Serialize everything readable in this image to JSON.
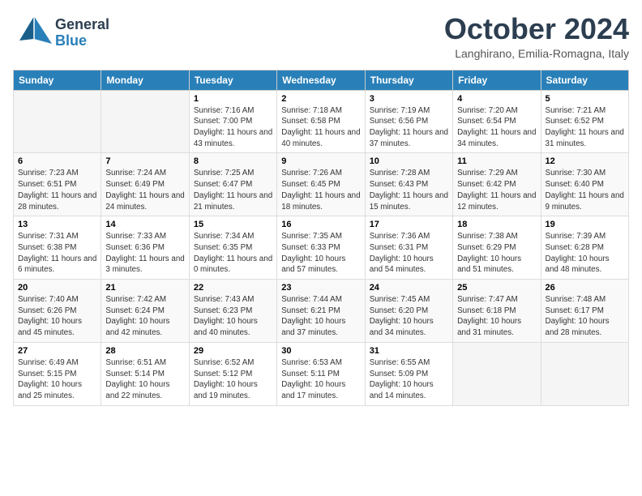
{
  "header": {
    "logo_general": "General",
    "logo_blue": "Blue",
    "month": "October 2024",
    "location": "Langhirano, Emilia-Romagna, Italy"
  },
  "days_of_week": [
    "Sunday",
    "Monday",
    "Tuesday",
    "Wednesday",
    "Thursday",
    "Friday",
    "Saturday"
  ],
  "weeks": [
    [
      {
        "day": "",
        "sunrise": "",
        "sunset": "",
        "daylight": ""
      },
      {
        "day": "",
        "sunrise": "",
        "sunset": "",
        "daylight": ""
      },
      {
        "day": "1",
        "sunrise": "Sunrise: 7:16 AM",
        "sunset": "Sunset: 7:00 PM",
        "daylight": "Daylight: 11 hours and 43 minutes."
      },
      {
        "day": "2",
        "sunrise": "Sunrise: 7:18 AM",
        "sunset": "Sunset: 6:58 PM",
        "daylight": "Daylight: 11 hours and 40 minutes."
      },
      {
        "day": "3",
        "sunrise": "Sunrise: 7:19 AM",
        "sunset": "Sunset: 6:56 PM",
        "daylight": "Daylight: 11 hours and 37 minutes."
      },
      {
        "day": "4",
        "sunrise": "Sunrise: 7:20 AM",
        "sunset": "Sunset: 6:54 PM",
        "daylight": "Daylight: 11 hours and 34 minutes."
      },
      {
        "day": "5",
        "sunrise": "Sunrise: 7:21 AM",
        "sunset": "Sunset: 6:52 PM",
        "daylight": "Daylight: 11 hours and 31 minutes."
      }
    ],
    [
      {
        "day": "6",
        "sunrise": "Sunrise: 7:23 AM",
        "sunset": "Sunset: 6:51 PM",
        "daylight": "Daylight: 11 hours and 28 minutes."
      },
      {
        "day": "7",
        "sunrise": "Sunrise: 7:24 AM",
        "sunset": "Sunset: 6:49 PM",
        "daylight": "Daylight: 11 hours and 24 minutes."
      },
      {
        "day": "8",
        "sunrise": "Sunrise: 7:25 AM",
        "sunset": "Sunset: 6:47 PM",
        "daylight": "Daylight: 11 hours and 21 minutes."
      },
      {
        "day": "9",
        "sunrise": "Sunrise: 7:26 AM",
        "sunset": "Sunset: 6:45 PM",
        "daylight": "Daylight: 11 hours and 18 minutes."
      },
      {
        "day": "10",
        "sunrise": "Sunrise: 7:28 AM",
        "sunset": "Sunset: 6:43 PM",
        "daylight": "Daylight: 11 hours and 15 minutes."
      },
      {
        "day": "11",
        "sunrise": "Sunrise: 7:29 AM",
        "sunset": "Sunset: 6:42 PM",
        "daylight": "Daylight: 11 hours and 12 minutes."
      },
      {
        "day": "12",
        "sunrise": "Sunrise: 7:30 AM",
        "sunset": "Sunset: 6:40 PM",
        "daylight": "Daylight: 11 hours and 9 minutes."
      }
    ],
    [
      {
        "day": "13",
        "sunrise": "Sunrise: 7:31 AM",
        "sunset": "Sunset: 6:38 PM",
        "daylight": "Daylight: 11 hours and 6 minutes."
      },
      {
        "day": "14",
        "sunrise": "Sunrise: 7:33 AM",
        "sunset": "Sunset: 6:36 PM",
        "daylight": "Daylight: 11 hours and 3 minutes."
      },
      {
        "day": "15",
        "sunrise": "Sunrise: 7:34 AM",
        "sunset": "Sunset: 6:35 PM",
        "daylight": "Daylight: 11 hours and 0 minutes."
      },
      {
        "day": "16",
        "sunrise": "Sunrise: 7:35 AM",
        "sunset": "Sunset: 6:33 PM",
        "daylight": "Daylight: 10 hours and 57 minutes."
      },
      {
        "day": "17",
        "sunrise": "Sunrise: 7:36 AM",
        "sunset": "Sunset: 6:31 PM",
        "daylight": "Daylight: 10 hours and 54 minutes."
      },
      {
        "day": "18",
        "sunrise": "Sunrise: 7:38 AM",
        "sunset": "Sunset: 6:29 PM",
        "daylight": "Daylight: 10 hours and 51 minutes."
      },
      {
        "day": "19",
        "sunrise": "Sunrise: 7:39 AM",
        "sunset": "Sunset: 6:28 PM",
        "daylight": "Daylight: 10 hours and 48 minutes."
      }
    ],
    [
      {
        "day": "20",
        "sunrise": "Sunrise: 7:40 AM",
        "sunset": "Sunset: 6:26 PM",
        "daylight": "Daylight: 10 hours and 45 minutes."
      },
      {
        "day": "21",
        "sunrise": "Sunrise: 7:42 AM",
        "sunset": "Sunset: 6:24 PM",
        "daylight": "Daylight: 10 hours and 42 minutes."
      },
      {
        "day": "22",
        "sunrise": "Sunrise: 7:43 AM",
        "sunset": "Sunset: 6:23 PM",
        "daylight": "Daylight: 10 hours and 40 minutes."
      },
      {
        "day": "23",
        "sunrise": "Sunrise: 7:44 AM",
        "sunset": "Sunset: 6:21 PM",
        "daylight": "Daylight: 10 hours and 37 minutes."
      },
      {
        "day": "24",
        "sunrise": "Sunrise: 7:45 AM",
        "sunset": "Sunset: 6:20 PM",
        "daylight": "Daylight: 10 hours and 34 minutes."
      },
      {
        "day": "25",
        "sunrise": "Sunrise: 7:47 AM",
        "sunset": "Sunset: 6:18 PM",
        "daylight": "Daylight: 10 hours and 31 minutes."
      },
      {
        "day": "26",
        "sunrise": "Sunrise: 7:48 AM",
        "sunset": "Sunset: 6:17 PM",
        "daylight": "Daylight: 10 hours and 28 minutes."
      }
    ],
    [
      {
        "day": "27",
        "sunrise": "Sunrise: 6:49 AM",
        "sunset": "Sunset: 5:15 PM",
        "daylight": "Daylight: 10 hours and 25 minutes."
      },
      {
        "day": "28",
        "sunrise": "Sunrise: 6:51 AM",
        "sunset": "Sunset: 5:14 PM",
        "daylight": "Daylight: 10 hours and 22 minutes."
      },
      {
        "day": "29",
        "sunrise": "Sunrise: 6:52 AM",
        "sunset": "Sunset: 5:12 PM",
        "daylight": "Daylight: 10 hours and 19 minutes."
      },
      {
        "day": "30",
        "sunrise": "Sunrise: 6:53 AM",
        "sunset": "Sunset: 5:11 PM",
        "daylight": "Daylight: 10 hours and 17 minutes."
      },
      {
        "day": "31",
        "sunrise": "Sunrise: 6:55 AM",
        "sunset": "Sunset: 5:09 PM",
        "daylight": "Daylight: 10 hours and 14 minutes."
      },
      {
        "day": "",
        "sunrise": "",
        "sunset": "",
        "daylight": ""
      },
      {
        "day": "",
        "sunrise": "",
        "sunset": "",
        "daylight": ""
      }
    ]
  ]
}
